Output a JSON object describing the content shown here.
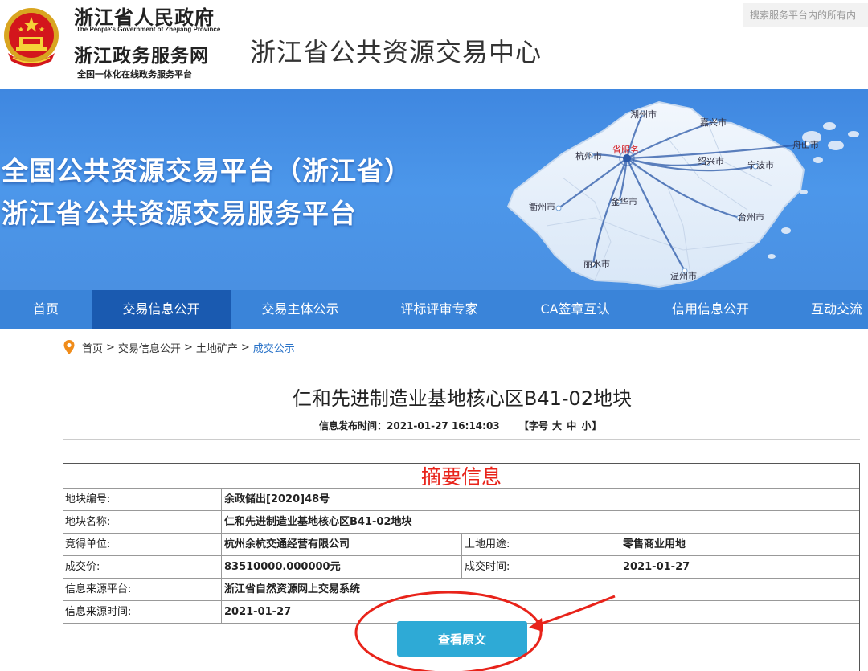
{
  "header": {
    "gov_title": "浙江省人民政府",
    "gov_subtitle_en": "The People's Government of Zhejiang Province",
    "service_title": "浙江政务服务网",
    "service_subtitle": "全国一体化在线政务服务平台",
    "center_title": "浙江省公共资源交易中心",
    "search_placeholder": "搜索服务平台内的所有内"
  },
  "banner": {
    "line1": "全国公共资源交易平台（浙江省）",
    "line2": "浙江省公共资源交易服务平台",
    "map_labels": {
      "huzhou": "湖州市",
      "jiaxing": "嘉兴市",
      "hangzhou": "杭州市",
      "hub": "省服务",
      "shaoxing": "绍兴市",
      "ningbo": "宁波市",
      "zhoushan": "舟山市",
      "quzhou": "衢州市",
      "jinhua": "金华市",
      "taizhou": "台州市",
      "lishui": "丽水市",
      "wenzhou": "温州市"
    }
  },
  "nav": {
    "items": [
      "首页",
      "交易信息公开",
      "交易主体公示",
      "评标评审专家",
      "CA签章互认",
      "信用信息公开",
      "互动交流"
    ],
    "active_index": 1
  },
  "breadcrumb": {
    "items": [
      "首页",
      "交易信息公开",
      "土地矿产",
      "成交公示"
    ],
    "separator": ">"
  },
  "article": {
    "title": "仁和先进制造业基地核心区B41-02地块",
    "publish_label": "信息发布时间：",
    "publish_time": "2021-01-27 16:14:03",
    "font_size_label": "【字号",
    "font_sizes": [
      "大",
      "中",
      "小"
    ],
    "font_size_close": "】"
  },
  "summary": {
    "heading": "摘要信息",
    "rows": {
      "parcel_no": {
        "label": "地块编号:",
        "value": "余政储出[2020]48号"
      },
      "parcel_name": {
        "label": "地块名称:",
        "value": "仁和先进制造业基地核心区B41-02地块"
      },
      "winner": {
        "label": "竞得单位:",
        "value": "杭州余杭交通经营有限公司"
      },
      "land_use": {
        "label": "土地用途:",
        "value": "零售商业用地"
      },
      "price": {
        "label": "成交价:",
        "value": "83510000.000000元"
      },
      "deal_time": {
        "label": "成交时间:",
        "value": "2021-01-27"
      },
      "source_platform": {
        "label": "信息来源平台:",
        "value": "浙江省自然资源网上交易系统"
      },
      "source_time": {
        "label": "信息来源时间:",
        "value": "2021-01-27"
      }
    },
    "button_label": "查看原文"
  },
  "colors": {
    "nav_bg": "#3a84d9",
    "nav_active": "#1a5ab0",
    "banner_bg": "#4a90e2",
    "heading_red": "#e8231a",
    "button_bg": "#2eaad6",
    "annotation_red": "#e8231a"
  },
  "icons": {
    "emblem": "national-emblem-icon",
    "breadcrumb": "location-pin-icon"
  }
}
